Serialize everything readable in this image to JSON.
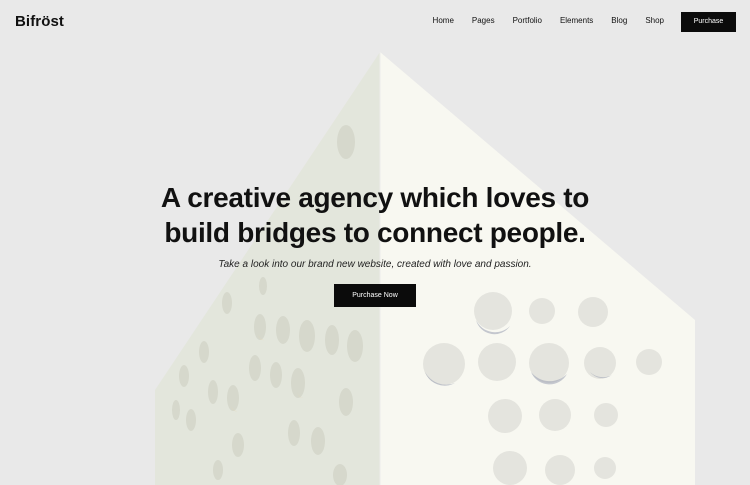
{
  "header": {
    "logo": "Bifröst",
    "nav": [
      "Home",
      "Pages",
      "Portfolio",
      "Elements",
      "Blog",
      "Shop"
    ],
    "purchase_label": "Purchase"
  },
  "hero": {
    "title_line1": "A creative agency which loves to",
    "title_line2": "build bridges to connect people.",
    "subtitle": "Take a look into our brand new website, created with love and passion.",
    "cta_label": "Purchase Now"
  },
  "colors": {
    "background": "#e9e9e9",
    "button": "#0b0b0b",
    "building_light": "#f7f7ef",
    "building_shade": "#e2e5db"
  }
}
